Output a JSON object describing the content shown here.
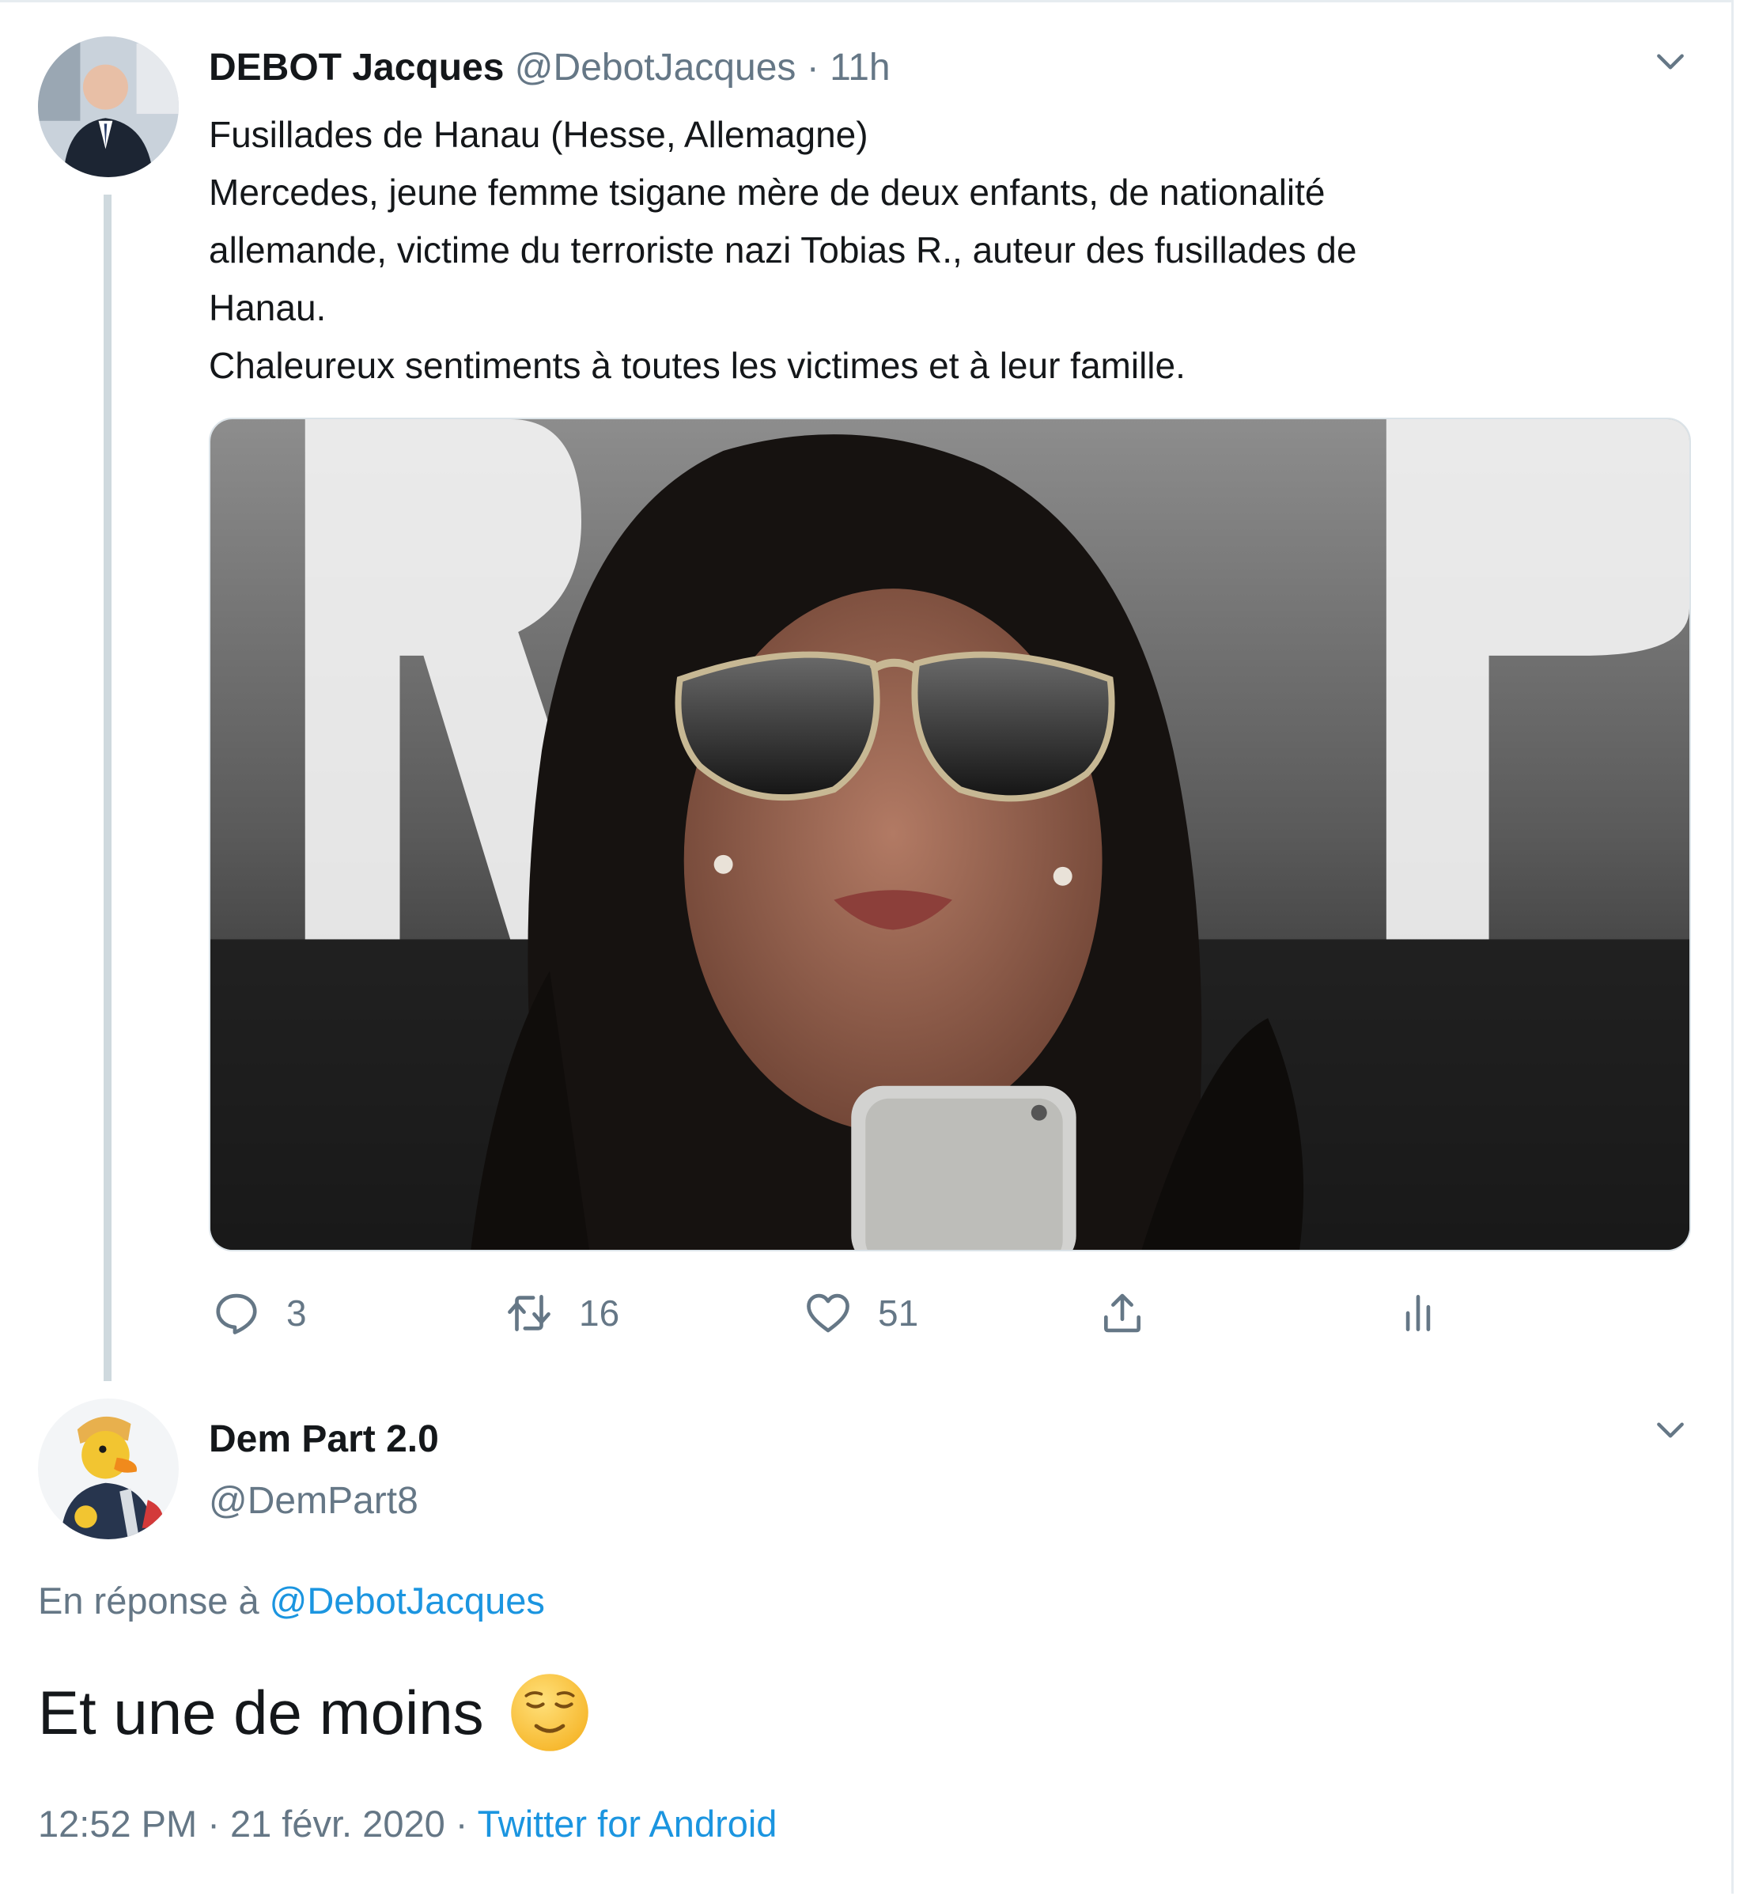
{
  "tweet": {
    "display_name": "DEBOT Jacques",
    "handle": "@DebotJacques",
    "separator": "·",
    "time": "11h",
    "lines": [
      "Fusillades de Hanau (Hesse, Allemagne)",
      "Mercedes, jeune femme tsigane mère de deux enfants, de nationalité",
      "allemande, victime du terroriste nazi Tobias R., auteur des fusillades de",
      "Hanau.",
      "Chaleureux sentiments à toutes les victimes et à leur famille."
    ],
    "actions": {
      "reply_icon": "reply-icon",
      "reply_count": "3",
      "retweet_icon": "retweet-icon",
      "retweet_count": "16",
      "like_icon": "heart-icon",
      "like_count": "51",
      "share_icon": "share-icon",
      "stats_icon": "analytics-icon"
    }
  },
  "reply": {
    "display_name": "Dem Part 2.0",
    "handle": "@DemPart8",
    "in_reply_prefix": "En réponse à",
    "in_reply_handle": "@DebotJacques",
    "text": "Et une de moins",
    "emoji": "relieved-face-emoji",
    "time": "12:52 PM",
    "separator": "·",
    "date": "21 févr. 2020",
    "source": "Twitter for Android"
  },
  "colors": {
    "text": "#14171a",
    "secondary": "#657786",
    "link": "#1b95e0",
    "thread_line": "#cfd9de"
  }
}
